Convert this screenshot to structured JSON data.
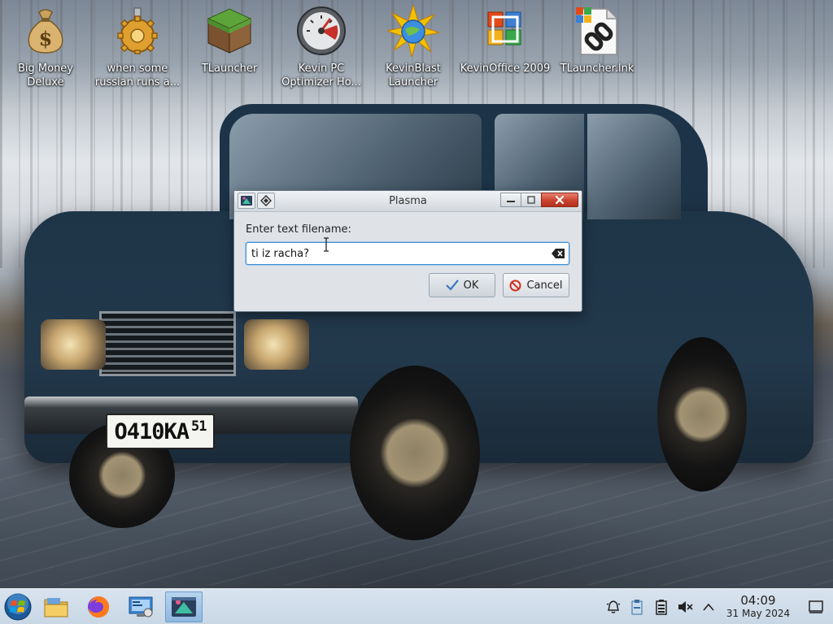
{
  "desktop": {
    "icons": [
      {
        "label": "Big Money Deluxe",
        "icon": "money-bag-icon"
      },
      {
        "label": "when some russian runs a...",
        "icon": "gear-icon"
      },
      {
        "label": "TLauncher",
        "icon": "grass-block-icon"
      },
      {
        "label": "Kevin PC Optimizer Ho...",
        "icon": "gauge-icon"
      },
      {
        "label": "KevinBlast Launcher",
        "icon": "blast-globe-icon"
      },
      {
        "label": "KevinOffice 2009",
        "icon": "office-logo-icon"
      },
      {
        "label": "TLauncher.lnk",
        "icon": "shortcut-link-icon"
      }
    ]
  },
  "wallpaper": {
    "license_plate": {
      "main": "O410KA",
      "region": "51"
    }
  },
  "dialog": {
    "title": "Plasma",
    "prompt_label": "Enter text filename:",
    "input_value": "ti iz racha?",
    "ok_label": "OK",
    "cancel_label": "Cancel"
  },
  "taskbar": {
    "items": [
      "start-orb-icon",
      "file-manager-icon",
      "firefox-icon",
      "control-panel-icon",
      "plasma-task-icon"
    ],
    "tray": [
      "notifications-bell-icon",
      "clipboard-icon",
      "battery-icon",
      "speaker-muted-icon",
      "tray-expand-icon"
    ],
    "clock": {
      "time": "04:09",
      "date": "31 May 2024"
    }
  },
  "colors": {
    "taskbar_bg": "#c9d7e5",
    "dialog_bg": "#dfe3e8",
    "close_red": "#c9432e",
    "focus_blue": "#3d8fd6"
  }
}
